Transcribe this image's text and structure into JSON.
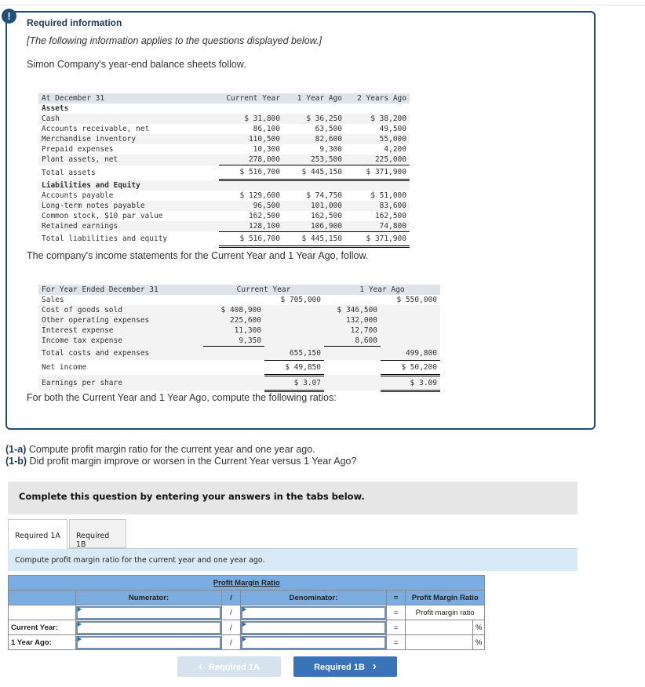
{
  "info": {
    "alert_icon": "!",
    "title": "Required information",
    "subtitle": "[The following information applies to the questions displayed below.]",
    "intro": "Simon Company's year-end balance sheets follow."
  },
  "balance_sheet": {
    "header": [
      "At December 31",
      "Current Year",
      "1 Year Ago",
      "2 Years Ago"
    ],
    "assets_label": "Assets",
    "assets": [
      {
        "label": "Cash",
        "values": [
          "$ 31,800",
          "$ 36,250",
          "$ 38,200"
        ]
      },
      {
        "label": "Accounts receivable, net",
        "values": [
          "86,100",
          "63,500",
          "49,500"
        ]
      },
      {
        "label": "Merchandise inventory",
        "values": [
          "110,500",
          "82,600",
          "55,000"
        ]
      },
      {
        "label": "Prepaid expenses",
        "values": [
          "10,300",
          "9,300",
          "4,200"
        ]
      },
      {
        "label": "Plant assets, net",
        "values": [
          "278,000",
          "253,500",
          "225,000"
        ]
      }
    ],
    "total_assets": {
      "label": "Total assets",
      "values": [
        "$ 516,700",
        "$ 445,150",
        "$ 371,900"
      ]
    },
    "liab_label": "Liabilities and Equity",
    "liabilities": [
      {
        "label": "Accounts payable",
        "values": [
          "$ 129,600",
          "$ 74,750",
          "$ 51,000"
        ]
      },
      {
        "label": "Long-term notes payable",
        "values": [
          "96,500",
          "101,000",
          "83,600"
        ]
      },
      {
        "label": "Common stock, $10 par value",
        "values": [
          "162,500",
          "162,500",
          "162,500"
        ]
      },
      {
        "label": "Retained earnings",
        "values": [
          "128,100",
          "106,900",
          "74,800"
        ]
      }
    ],
    "total_liab": {
      "label": "Total liabilities and equity",
      "values": [
        "$ 516,700",
        "$ 445,150",
        "$ 371,900"
      ]
    }
  },
  "income_intro": "The company's income statements for the Current Year and 1 Year Ago, follow.",
  "income_statement": {
    "header": [
      "For Year Ended December 31",
      "Current Year",
      "1 Year Ago"
    ],
    "sales": {
      "label": "Sales",
      "current": "$ 705,000",
      "prior": "$ 550,000"
    },
    "expenses": [
      {
        "label": "Cost of goods sold",
        "current": "$ 408,900",
        "prior": "$ 346,500"
      },
      {
        "label": "Other operating expenses",
        "current": "225,600",
        "prior": "132,000"
      },
      {
        "label": "Interest expense",
        "current": "11,300",
        "prior": "12,700"
      },
      {
        "label": "Income tax expense",
        "current": "9,350",
        "prior": "8,600"
      }
    ],
    "total_costs": {
      "label": "Total costs and expenses",
      "current": "655,150",
      "prior": "499,800"
    },
    "net_income": {
      "label": "Net income",
      "current": "$ 49,850",
      "prior": "$ 50,200"
    },
    "eps": {
      "label": "Earnings per share",
      "current": "$ 3.07",
      "prior": "$ 3.09"
    }
  },
  "ratios_intro": "For both the Current Year and 1 Year Ago, compute the following ratios:",
  "questions": [
    {
      "tag": "(1-a)",
      "text": " Compute profit margin ratio for the current year and one year ago."
    },
    {
      "tag": "(1-b)",
      "text": " Did profit margin improve or worsen in the Current Year versus 1 Year Ago?"
    }
  ],
  "instructions": "Complete this question by entering your answers in the tabs below.",
  "tabs": [
    {
      "label": "Required 1A",
      "active": true
    },
    {
      "label": "Required 1B",
      "active": false
    }
  ],
  "prompt": "Compute profit margin ratio for the current year and one year ago.",
  "ratio_table": {
    "title": "Profit Margin Ratio",
    "col_numerator": "Numerator:",
    "col_div": "/",
    "col_denominator": "Denominator:",
    "col_eq": "=",
    "col_result": "Profit Margin Ratio",
    "result_placeholder": "Profit margin ratio",
    "rows": [
      {
        "label": "",
        "numerator": "",
        "denominator": "",
        "result": ""
      },
      {
        "label": "Current Year:",
        "numerator": "",
        "denominator": "",
        "result": "",
        "unit": "%"
      },
      {
        "label": "1 Year Ago:",
        "numerator": "",
        "denominator": "",
        "result": "",
        "unit": "%"
      }
    ]
  },
  "nav": {
    "prev_label": "Required 1A",
    "next_label": "Required 1B",
    "prev_icon": "‹",
    "next_icon": "›"
  }
}
